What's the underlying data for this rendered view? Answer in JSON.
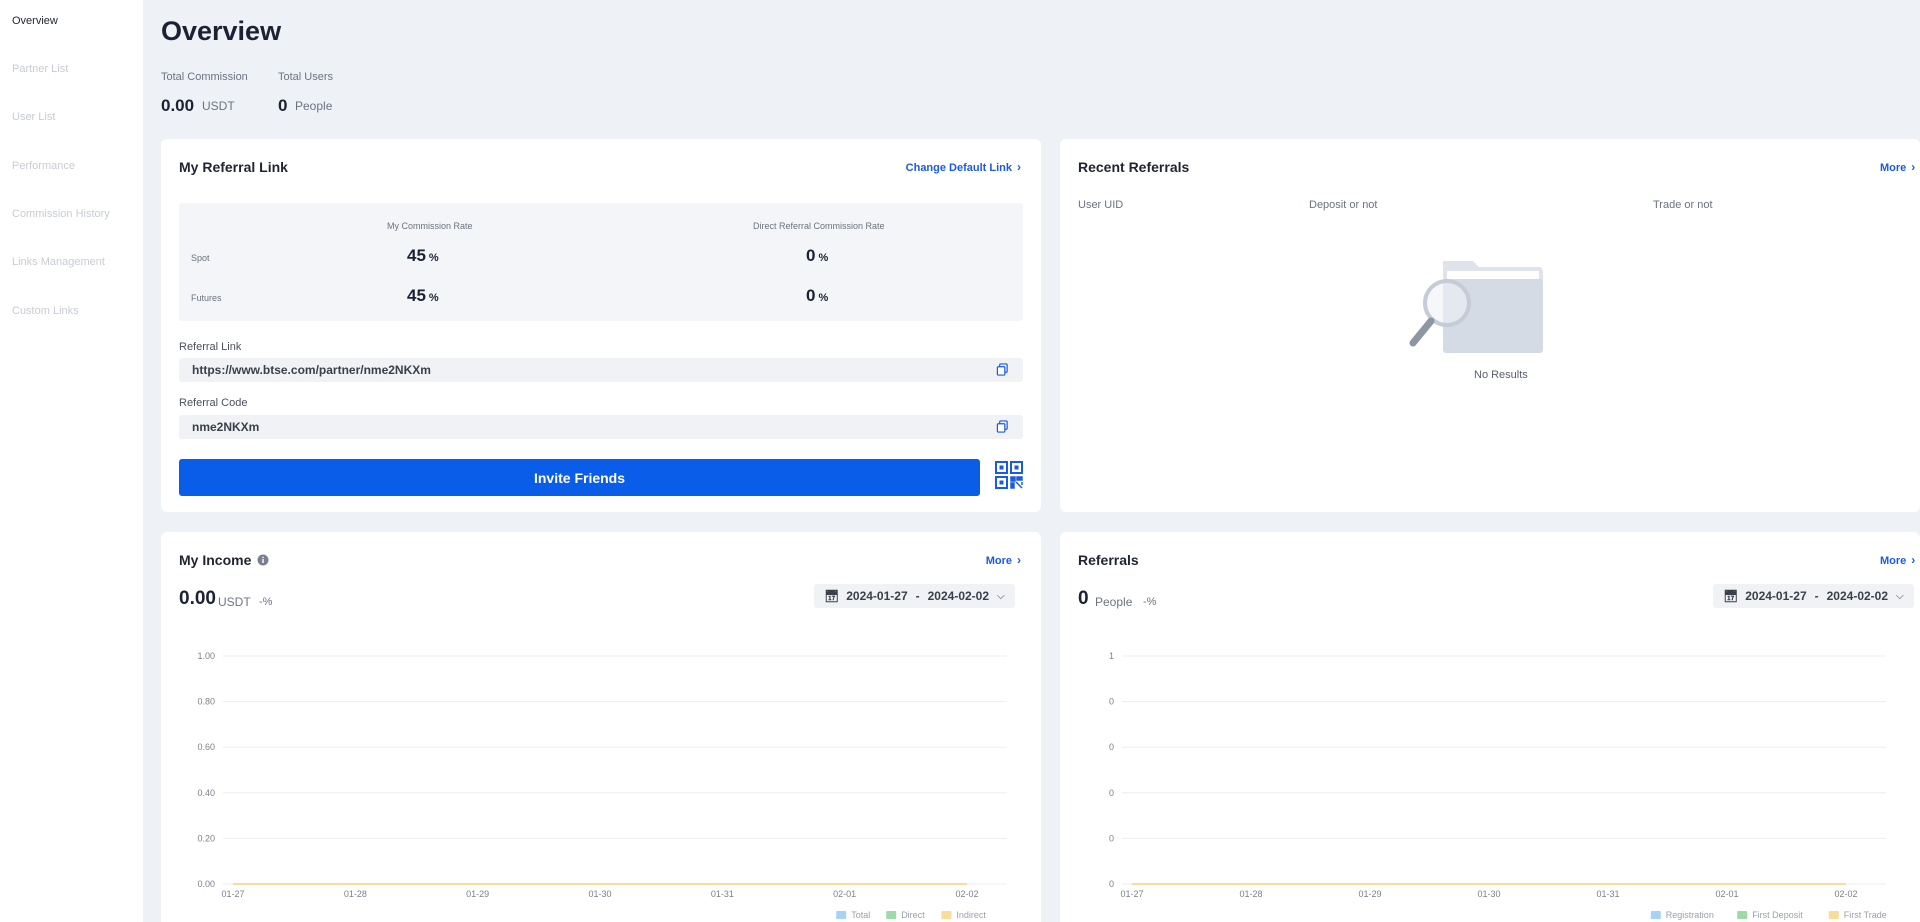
{
  "sidebar": {
    "items": [
      {
        "label": "Overview"
      },
      {
        "label": "Partner List"
      },
      {
        "label": "User List"
      },
      {
        "label": "Performance"
      },
      {
        "label": "Commission History"
      },
      {
        "label": "Links Management"
      },
      {
        "label": "Custom Links"
      }
    ]
  },
  "header": {
    "title": "Overview",
    "total_commission_label": "Total Commission",
    "total_commission_value": "0.00",
    "total_commission_unit": "USDT",
    "total_users_label": "Total Users",
    "total_users_value": "0",
    "total_users_unit": "People"
  },
  "referral_link_card": {
    "title": "My Referral Link",
    "change_link_label": "Change Default Link",
    "my_rate_header": "My Commission Rate",
    "direct_rate_header": "Direct Referral Commission Rate",
    "rows": [
      {
        "label": "Spot",
        "my_rate": "45",
        "direct_rate": "0",
        "unit": "%"
      },
      {
        "label": "Futures",
        "my_rate": "45",
        "direct_rate": "0",
        "unit": "%"
      }
    ],
    "referral_link_label": "Referral Link",
    "referral_link_value": "https://www.btse.com/partner/nme2NKXm",
    "referral_code_label": "Referral Code",
    "referral_code_value": "nme2NKXm",
    "invite_button": "Invite Friends"
  },
  "recent_referrals_card": {
    "title": "Recent Referrals",
    "more_label": "More",
    "columns": [
      "User UID",
      "Deposit or not",
      "Trade or not"
    ],
    "empty_text": "No Results"
  },
  "income_card": {
    "title": "My Income",
    "more_label": "More",
    "value": "0.00",
    "unit": "USDT",
    "change": "-%",
    "date_from": "2024-01-27",
    "date_to": "2024-02-02",
    "date_sep": "-",
    "legend": [
      "Total",
      "Direct",
      "Indirect"
    ]
  },
  "referrals_card": {
    "title": "Referrals",
    "more_label": "More",
    "value": "0",
    "unit": "People",
    "change": "-%",
    "date_from": "2024-01-27",
    "date_to": "2024-02-02",
    "date_sep": "-",
    "legend": [
      "Registration",
      "First Deposit",
      "First Trade"
    ]
  },
  "colors": {
    "accent": "#0a5de8",
    "link": "#1a5ce0",
    "series_total": "#a9d0f5",
    "series_direct": "#9fd9a8",
    "series_indirect": "#f7dc9a",
    "series_line": "#9fd9a8"
  },
  "chart_data": [
    {
      "type": "line",
      "name": "My Income",
      "x": [
        "01-27",
        "01-28",
        "01-29",
        "01-30",
        "01-31",
        "02-01",
        "02-02"
      ],
      "ytick_labels": [
        "0.00",
        "0.20",
        "0.40",
        "0.60",
        "0.80",
        "1.00"
      ],
      "ylim": [
        0,
        1
      ],
      "grid": true,
      "legend_position": "bottom-right",
      "series": [
        {
          "name": "Total",
          "values": [
            0,
            0,
            0,
            0,
            0,
            0,
            0
          ]
        },
        {
          "name": "Direct",
          "values": [
            0,
            0,
            0,
            0,
            0,
            0,
            0
          ]
        },
        {
          "name": "Indirect",
          "values": [
            0,
            0,
            0,
            0,
            0,
            0,
            0
          ]
        }
      ]
    },
    {
      "type": "line",
      "name": "Referrals",
      "x": [
        "01-27",
        "01-28",
        "01-29",
        "01-30",
        "01-31",
        "02-01",
        "02-02"
      ],
      "ytick_labels": [
        "0",
        "0",
        "0",
        "0",
        "0",
        "1"
      ],
      "ylim": [
        0,
        1
      ],
      "grid": true,
      "legend_position": "bottom-right",
      "series": [
        {
          "name": "Registration",
          "values": [
            0,
            0,
            0,
            0,
            0,
            0,
            0
          ]
        },
        {
          "name": "First Deposit",
          "values": [
            0,
            0,
            0,
            0,
            0,
            0,
            0
          ]
        },
        {
          "name": "First Trade",
          "values": [
            0,
            0,
            0,
            0,
            0,
            0,
            0
          ]
        }
      ]
    }
  ]
}
